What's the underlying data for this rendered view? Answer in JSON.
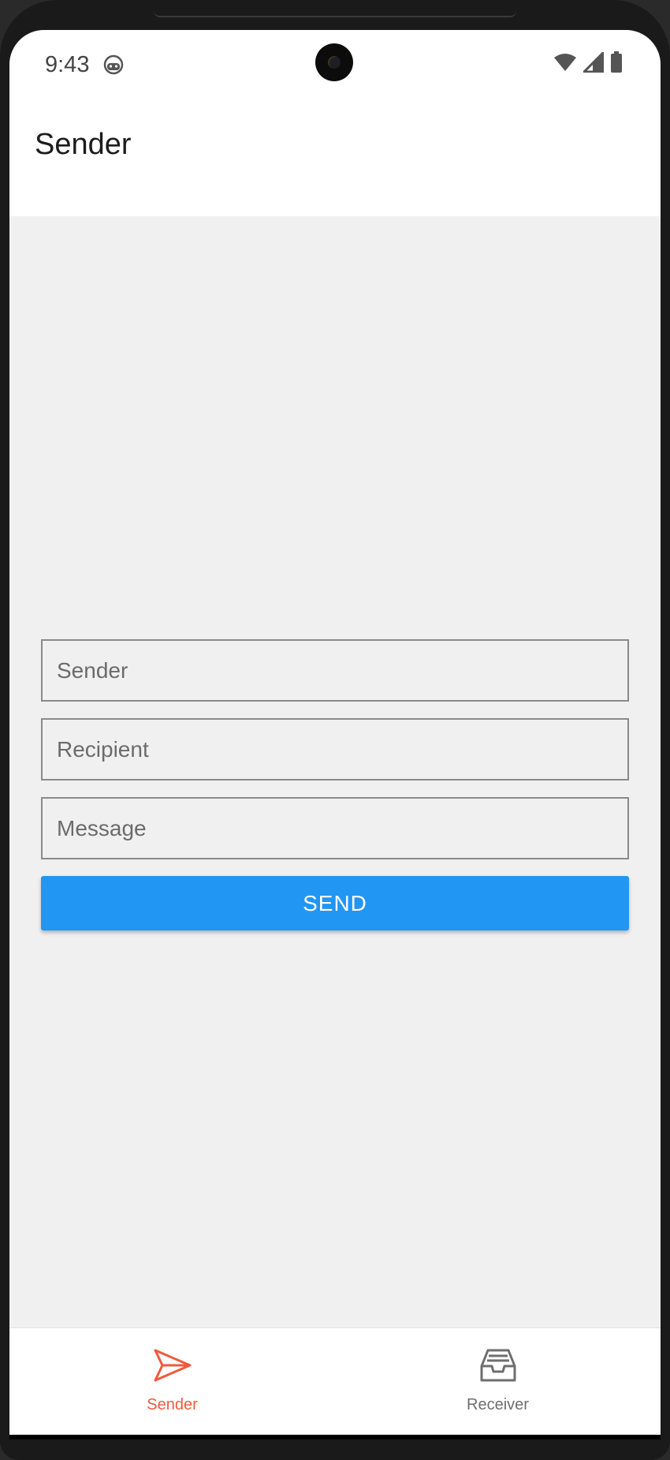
{
  "status_bar": {
    "time": "9:43",
    "app_icon": "android-face-icon",
    "icons": [
      "wifi-icon",
      "signal-icon",
      "battery-icon"
    ]
  },
  "app_bar": {
    "title": "Sender"
  },
  "form": {
    "sender_placeholder": "Sender",
    "recipient_placeholder": "Recipient",
    "message_placeholder": "Message",
    "send_label": "SEND"
  },
  "tabs": [
    {
      "label": "Sender",
      "icon": "send-icon",
      "active": true
    },
    {
      "label": "Receiver",
      "icon": "inbox-icon",
      "active": false
    }
  ],
  "colors": {
    "accent": "#2196f3",
    "active_tab": "#f05a3c",
    "inactive_tab": "#6e6e6e"
  }
}
